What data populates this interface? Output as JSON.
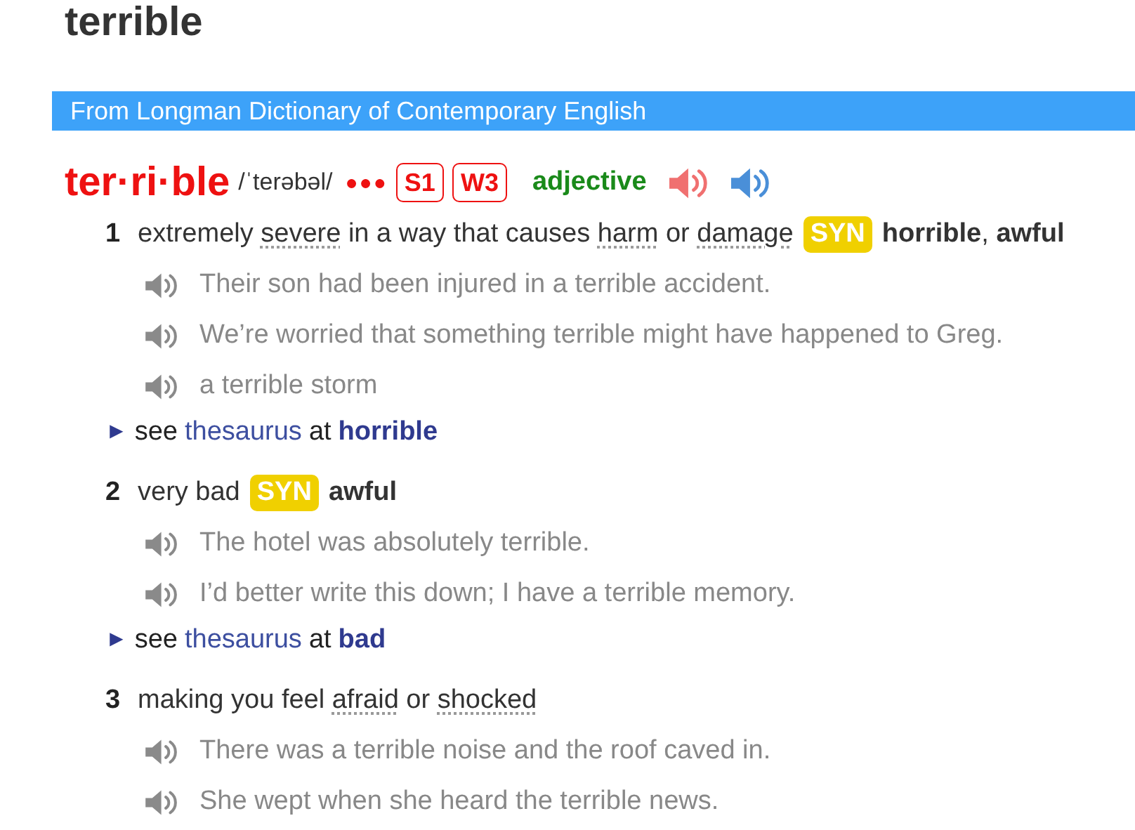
{
  "page_title": "terrible",
  "source_bar": "From Longman Dictionary of Contemporary English",
  "headword": {
    "word": "ter·ri·ble",
    "pronunciation": "/ˈterəbəl/",
    "frequency_dots": "●●●",
    "badges": [
      "S1",
      "W3"
    ],
    "part_of_speech": "adjective"
  },
  "senses": [
    {
      "number": "1",
      "definition": [
        {
          "text": "extremely "
        },
        {
          "text": "severe",
          "link": true
        },
        {
          "text": " in a way that causes "
        },
        {
          "text": "harm",
          "link": true
        },
        {
          "text": " or "
        },
        {
          "text": "damage",
          "link": true
        }
      ],
      "syn_label": "SYN",
      "synonyms": "**horrible**, **awful**",
      "examples": [
        "Their son had been injured in a terrible accident.",
        "We’re worried that something terrible might have happened to Greg.",
        "a terrible storm"
      ],
      "see_also": {
        "marker": "►",
        "see": "see",
        "link": "thesaurus",
        "at": "at",
        "target": "horrible"
      }
    },
    {
      "number": "2",
      "definition": [
        {
          "text": "very bad"
        }
      ],
      "syn_label": "SYN",
      "synonyms": "**awful**",
      "examples": [
        "The hotel was absolutely terrible.",
        "I’d better write this down; I have a terrible memory."
      ],
      "see_also": {
        "marker": "►",
        "see": "see",
        "link": "thesaurus",
        "at": "at",
        "target": "bad"
      }
    },
    {
      "number": "3",
      "definition": [
        {
          "text": "making you feel "
        },
        {
          "text": "afraid",
          "link": true
        },
        {
          "text": " or "
        },
        {
          "text": "shocked",
          "link": true
        }
      ],
      "examples": [
        "There was a terrible noise and the roof caved in.",
        "She wept when she heard the terrible news."
      ]
    }
  ]
}
